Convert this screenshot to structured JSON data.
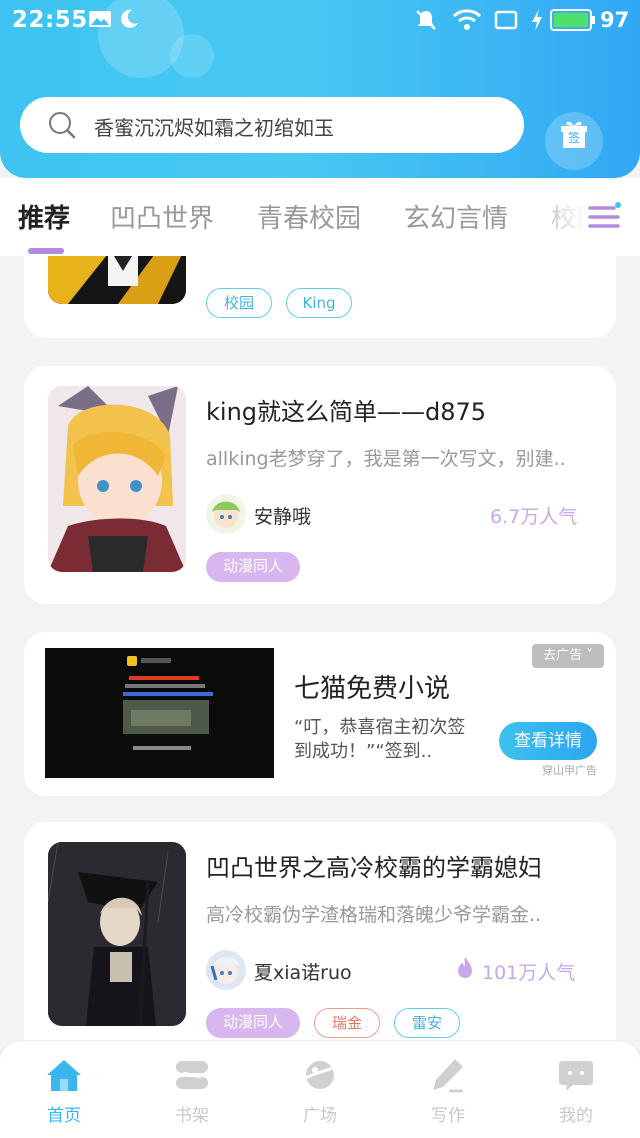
{
  "status_bar": {
    "time": "22:55",
    "battery": "97"
  },
  "search": {
    "placeholder": "香蜜沉沉烬如霜之初绾如玉"
  },
  "gift": {
    "label": "签"
  },
  "tabs": [
    {
      "label": "推荐",
      "active": true
    },
    {
      "label": "凹凸世界"
    },
    {
      "label": "青春校园"
    },
    {
      "label": "玄幻言情"
    },
    {
      "label": "校园"
    }
  ],
  "feed": {
    "partial_card": {
      "tags": [
        "校园",
        "King"
      ]
    },
    "book1": {
      "title": "king就这么简单——d875",
      "desc": "allking老梦穿了，我是第一次写文，别建..",
      "author": "安静哦",
      "popularity": "6.7万人气",
      "tags": [
        "动漫同人"
      ]
    },
    "ad": {
      "title": "七猫免费小说",
      "desc": "“叮，恭喜宿主初次签到成功！”“签到..",
      "button": "查看详情",
      "close": "去广告",
      "source": "穿山甲广告"
    },
    "book2": {
      "title": "凹凸世界之高冷校霸的学霸媳妇",
      "desc": "高冷校霸伪学渣格瑞和落魄少爷学霸金..",
      "author": "夏xia诺ruo",
      "popularity": "101万人气",
      "tags": [
        "动漫同人",
        "瑞金",
        "雷安"
      ]
    }
  },
  "bottom_nav": [
    {
      "label": "首页",
      "icon": "home-icon",
      "active": true
    },
    {
      "label": "书架",
      "icon": "bookshelf-icon"
    },
    {
      "label": "广场",
      "icon": "planet-icon"
    },
    {
      "label": "写作",
      "icon": "pen-icon"
    },
    {
      "label": "我的",
      "icon": "chat-icon"
    }
  ],
  "colors": {
    "accent": "#3ab6ee",
    "header_start": "#3ec3f2",
    "tag_purple": "#d8b7f1",
    "popularity": "#c8a7ea"
  }
}
